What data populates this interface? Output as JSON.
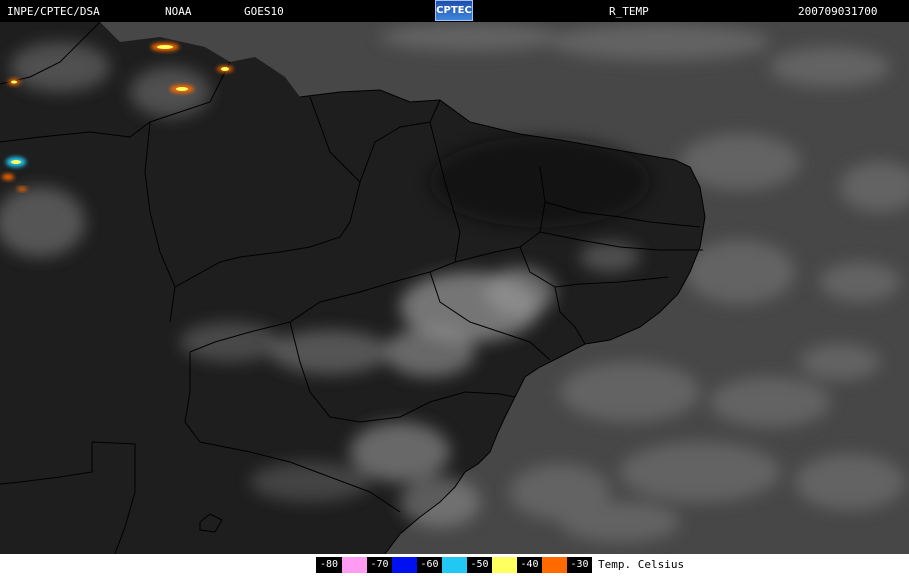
{
  "header": {
    "source": "INPE/CPTEC/DSA",
    "agency": "NOAA",
    "satellite": "GOES10",
    "logo_text": "CPTEC",
    "product": "R_TEMP",
    "datetime": "200709031700"
  },
  "legend": {
    "title": "Temp. Celsius",
    "entries": [
      {
        "label": "-80",
        "color": "#ff9bf0"
      },
      {
        "label": "-70",
        "color": "#0010f0"
      },
      {
        "label": "-60",
        "color": "#22c8f4"
      },
      {
        "label": "-50",
        "color": "#ffff60"
      },
      {
        "label": "-40",
        "color": "#ff6a00"
      },
      {
        "label": "-30",
        "color": ""
      }
    ]
  },
  "colors": {
    "land": "#1e1e1e",
    "ocean": "#474747",
    "cloud": "#a8a8a8",
    "border": "#000000"
  }
}
